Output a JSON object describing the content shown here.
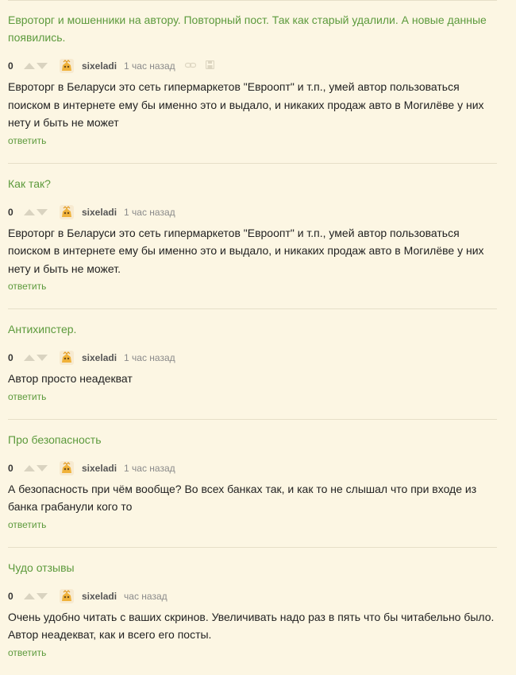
{
  "comments": [
    {
      "title": "Евроторг и мошенники на автору. Повторный пост. Так как старый удалили. А новые данные появились.",
      "rating": "0",
      "user": "sixeladi",
      "time": "1 час назад",
      "body": "Евроторг в Беларуси это сеть гипермаркетов \"Евроопт\" и т.п., умей автор пользоваться поиском в интернете ему бы именно это и выдало, и никаких продаж авто в Могилёве у них нету и быть не может",
      "reply": "ответить",
      "extra_icons": [
        "link-icon",
        "save-icon"
      ]
    },
    {
      "title": "Как так?",
      "rating": "0",
      "user": "sixeladi",
      "time": "1 час назад",
      "body": "Евроторг в Беларуси это сеть гипермаркетов \"Евроопт\" и т.п., умей автор пользоваться поиском в интернете ему бы именно это и выдало, и никаких продаж авто в Могилёве у них нету и быть не может.",
      "reply": "ответить"
    },
    {
      "title": "Антихипстер.",
      "rating": "0",
      "user": "sixeladi",
      "time": "1 час назад",
      "body": "Автор просто неадекват",
      "reply": "ответить"
    },
    {
      "title": "Про безопасность",
      "rating": "0",
      "user": "sixeladi",
      "time": "1 час назад",
      "body": "А безопасность при чём вообще? Во всех банках так, и как то не слышал что при входе из банка грабанули кого то",
      "reply": "ответить"
    },
    {
      "title": "Чудо отзывы",
      "rating": "0",
      "user": "sixeladi",
      "time": "час назад",
      "body": "Очень удобно читать с ваших скринов. Увеличивать надо раз в пять что бы читабельно было. Автор неадекват, как и всего его посты.",
      "reply": "ответить"
    }
  ],
  "colors": {
    "background": "#fcf6e3",
    "accent_green": "#5c9a3c",
    "divider": "#e6dfc8",
    "arrow": "#d9d3c0"
  }
}
